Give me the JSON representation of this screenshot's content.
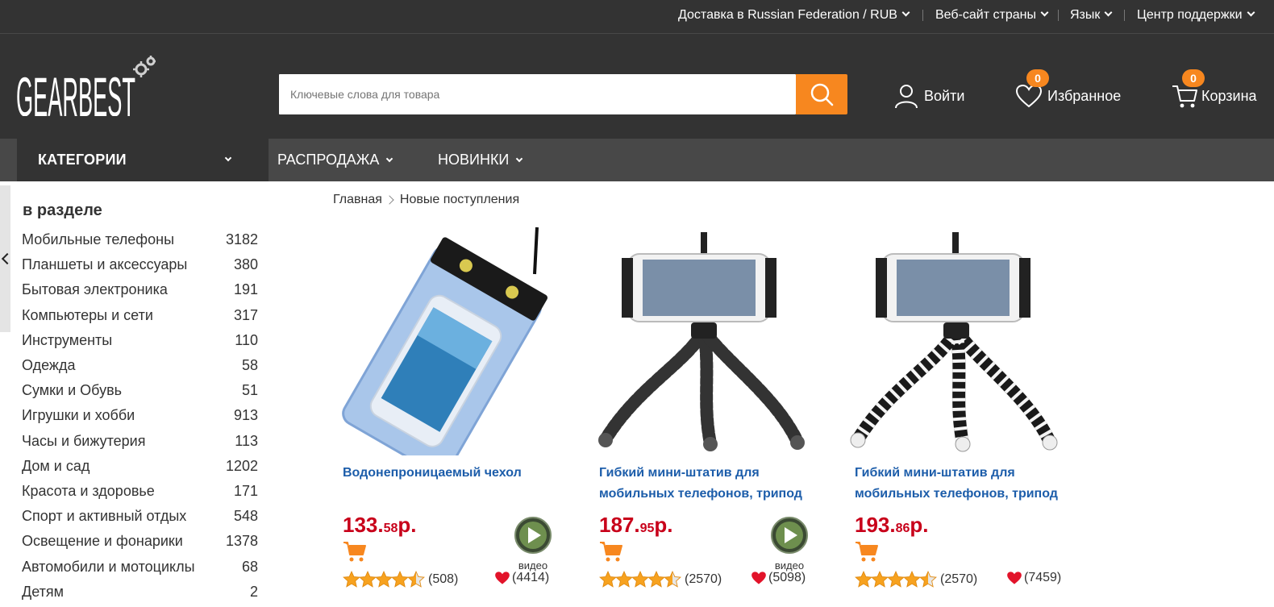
{
  "topbar": {
    "delivery": "Доставка в Russian Federation / RUB",
    "country_site": "Веб-сайт страны",
    "language": "Язык",
    "support": "Центр поддержки"
  },
  "header": {
    "logo_text": "GEARBEST",
    "search_placeholder": "Ключевые слова для товара",
    "login": "Войти",
    "favorites": "Избранное",
    "favorites_count": "0",
    "cart": "Корзина",
    "cart_count": "0"
  },
  "nav": {
    "categories": "КАТЕГОРИИ",
    "sale": "РАСПРОДАЖА",
    "new": "НОВИНКИ"
  },
  "sidebar": {
    "title": "в разделе",
    "items": [
      {
        "label": "Мобильные телефоны",
        "count": "3182"
      },
      {
        "label": "Планшеты и аксессуары",
        "count": "380"
      },
      {
        "label": "Бытовая электроника",
        "count": "191"
      },
      {
        "label": "Компьютеры и сети",
        "count": "317"
      },
      {
        "label": "Инструменты",
        "count": "110"
      },
      {
        "label": "Одежда",
        "count": "58"
      },
      {
        "label": "Сумки и Обувь",
        "count": "51"
      },
      {
        "label": "Игрушки и хобби",
        "count": "913"
      },
      {
        "label": "Часы и бижутерия",
        "count": "113"
      },
      {
        "label": "Дом и сад",
        "count": "1202"
      },
      {
        "label": "Красота и здоровье",
        "count": "171"
      },
      {
        "label": "Спорт и активный отдых",
        "count": "548"
      },
      {
        "label": "Освещение и фонарики",
        "count": "1378"
      },
      {
        "label": "Автомобили и мотоциклы",
        "count": "68"
      },
      {
        "label": "Детям",
        "count": "2"
      }
    ]
  },
  "breadcrumb": {
    "home": "Главная",
    "current": "Новые поступления"
  },
  "products": [
    {
      "title": "Водонепроницаемый чехол",
      "price_main": "133.",
      "price_cents": "58",
      "price_currency": "р.",
      "has_video": true,
      "video_label": "видео",
      "rating": 4.5,
      "reviews": "(508)",
      "favorites": "(4414)"
    },
    {
      "title": "Гибкий мини-штатив для мобильных телефонов, трипод",
      "price_main": "187.",
      "price_cents": "95",
      "price_currency": "р.",
      "has_video": true,
      "video_label": "видео",
      "rating": 4.5,
      "reviews": "(2570)",
      "favorites": "(5098)"
    },
    {
      "title": "Гибкий мини-штатив для мобильных телефонов, трипод",
      "price_main": "193.",
      "price_cents": "86",
      "price_currency": "р.",
      "has_video": false,
      "rating": 4.5,
      "reviews": "(2570)",
      "favorites": "(7459)"
    }
  ],
  "colors": {
    "accent": "#f7871f",
    "price": "#c8001a",
    "link": "#1c5daa",
    "header_bg": "#333333"
  }
}
